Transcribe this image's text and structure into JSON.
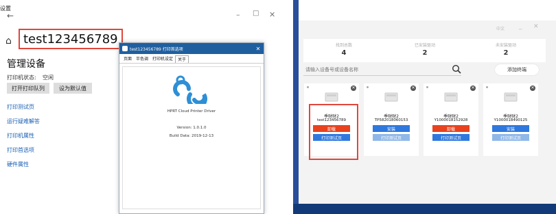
{
  "colors": {
    "highlight": "#e0463a",
    "uninstall": "#e8421e",
    "install": "#2f78de",
    "test_enabled": "#2f78de",
    "test_disabled": "#8fb8e8",
    "link": "#1a5fb4",
    "dialog_titlebar": "#1f5f9f",
    "logo": "#2e8fd6"
  },
  "settings": {
    "title": "设置",
    "back_icon": "arrow-left-icon",
    "home_icon": "home-icon",
    "printer_name": "test123456789",
    "manage_title": "管理设备",
    "status_label": "打印机状态:",
    "status_value": "空闲",
    "buttons": {
      "open_queue": "打开打印队列",
      "set_default": "设为默认值"
    },
    "links": [
      "打印测试页",
      "运行疑难解答",
      "打印机属性",
      "打印首选项",
      "硬件属性"
    ]
  },
  "dialog": {
    "title": "test123456789 打印首选项",
    "tabs": [
      "页面",
      "半色调",
      "打印机设定",
      "关于"
    ],
    "active_tab": 3,
    "product": "HPRT Cloud Printer Driver",
    "version": "Version: 1.0.1.0",
    "build": "Build Data: 2019-12-13"
  },
  "manager": {
    "lang": "中文",
    "stats": [
      {
        "label": "找到总数",
        "value": "4"
      },
      {
        "label": "已安装驱动",
        "value": "2"
      },
      {
        "label": "未安装驱动",
        "value": "2"
      }
    ],
    "search_placeholder": "请输入设备号或设备名称",
    "add_button": "添加终端",
    "cards": [
      {
        "model": "季财财2",
        "serial": "test123456789",
        "action": "卸载",
        "action_type": "uninstall",
        "test": "打印测试页",
        "test_enabled": true
      },
      {
        "model": "季财财2",
        "serial": "TP582018060153",
        "action": "安装",
        "action_type": "install",
        "test": "打印测试页",
        "test_enabled": false
      },
      {
        "model": "季财财2",
        "serial": "Y1000018152928",
        "action": "卸载",
        "action_type": "uninstall",
        "test": "打印测试页",
        "test_enabled": true
      },
      {
        "model": "季财财2",
        "serial": "Y1000018490125",
        "action": "安装",
        "action_type": "install",
        "test": "打印测试页",
        "test_enabled": false
      }
    ]
  }
}
